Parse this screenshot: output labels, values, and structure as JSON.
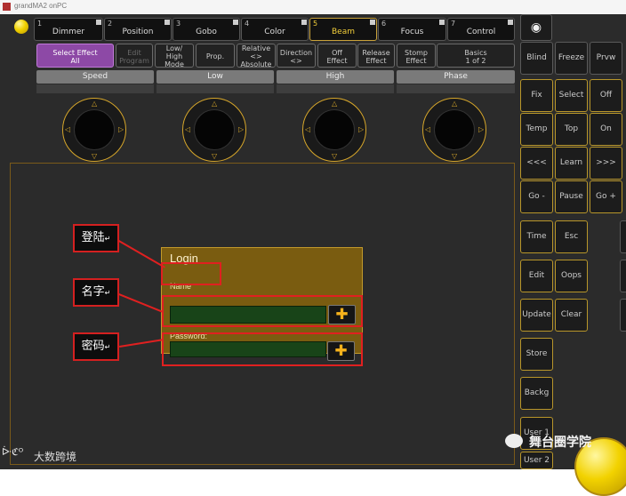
{
  "window": {
    "title": "grandMA2 onPC"
  },
  "preset_tabs": [
    {
      "num": "1",
      "label": "Dimmer",
      "active": false
    },
    {
      "num": "2",
      "label": "Position",
      "active": false
    },
    {
      "num": "3",
      "label": "Gobo",
      "active": false
    },
    {
      "num": "4",
      "label": "Color",
      "active": false
    },
    {
      "num": "5",
      "label": "Beam",
      "active": true
    },
    {
      "num": "6",
      "label": "Focus",
      "active": false
    },
    {
      "num": "7",
      "label": "Control",
      "active": false
    }
  ],
  "function_buttons": [
    {
      "label": "Select Effect\nAll",
      "selected": true,
      "disabled": false
    },
    {
      "label": "Edit\nProgram",
      "selected": false,
      "disabled": true
    },
    {
      "label": "Low/\nHigh\nMode",
      "selected": false,
      "disabled": false
    },
    {
      "label": "Prop.",
      "selected": false,
      "disabled": false
    },
    {
      "label": "Relative\n<>\nAbsolute",
      "selected": false,
      "disabled": false
    },
    {
      "label": "Direction\n<>",
      "selected": false,
      "disabled": false
    },
    {
      "label": "Off\nEffect",
      "selected": false,
      "disabled": false
    },
    {
      "label": "Release\nEffect",
      "selected": false,
      "disabled": false
    },
    {
      "label": "Stomp\nEffect",
      "selected": false,
      "disabled": false
    },
    {
      "label": "Basics\n1 of 2",
      "selected": false,
      "disabled": false
    }
  ],
  "encoders": [
    {
      "label": "Speed"
    },
    {
      "label": "Low"
    },
    {
      "label": "High"
    },
    {
      "label": "Phase"
    }
  ],
  "login": {
    "title": "Login",
    "name_label": "Name",
    "password_label": "Password:",
    "plus_symbol": "✚"
  },
  "annotations": {
    "login": "登陆",
    "name": "名字",
    "password": "密码",
    "arrow": "↵"
  },
  "right_panel": {
    "target_icon": "◉",
    "buttons": [
      "Blind",
      "Freeze",
      "Prvw",
      "Fix",
      "Select",
      "Off",
      "Temp",
      "Top",
      "On",
      "<<<",
      "Learn",
      ">>>",
      "Go -",
      "Pause",
      "Go +",
      "Time",
      "Esc",
      "Edit",
      "Oops",
      "Update",
      "Clear",
      "Store",
      "Backg",
      "User 1",
      "User 2"
    ]
  },
  "watermark": {
    "left_text": "大数跨境",
    "left_logo": "ᐕℭᴼ",
    "right_text": "舞台圈学院"
  },
  "colors": {
    "accent_gold": "#d6a62a",
    "active_tab_text": "#f3cf3a",
    "selected_purple": "#8d49a6",
    "dialog_bg": "#7a5c10",
    "input_green": "#184418",
    "annotation_red": "#e02020"
  }
}
